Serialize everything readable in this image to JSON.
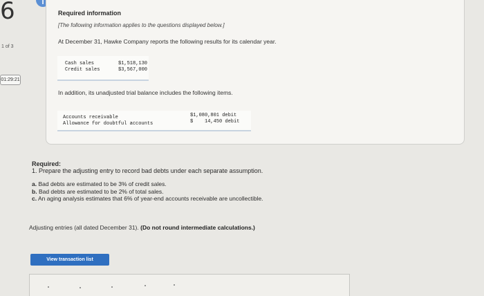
{
  "corner": {
    "question_number": "6",
    "page_count": "1 of 3",
    "timer": "01:29:21",
    "info_icon": "info-icon"
  },
  "info_panel": {
    "title": "Required information",
    "note": "[The following information applies to the questions displayed below.]",
    "intro": "At December 31, Hawke Company reports the following results for its calendar year.",
    "results": [
      {
        "label": "Cash sales",
        "value": "$1,518,130"
      },
      {
        "label": "Credit sales",
        "value": "$3,567,000"
      }
    ],
    "balance_intro": "In addition, its unadjusted trial balance includes the following items.",
    "balances": [
      {
        "label": "Accounts receivable",
        "value": "$1,080,801 debit"
      },
      {
        "label": "Allowance for doubtful accounts",
        "value": "$    14,450 debit"
      }
    ]
  },
  "required": {
    "heading": "Required:",
    "task": "1. Prepare the adjusting entry to record bad debts under each separate assumption.",
    "items": [
      {
        "letter": "a.",
        "text": "Bad debts are estimated to be 3% of credit sales."
      },
      {
        "letter": "b.",
        "text": "Bad debts are estimated to be 2% of total sales."
      },
      {
        "letter": "c.",
        "text": "An aging analysis estimates that 6% of year-end accounts receivable are uncollectible."
      }
    ]
  },
  "adjusting": {
    "text": "Adjusting entries (all dated December 31).",
    "bold_note": "(Do not round intermediate calculations.)"
  },
  "view_button": "View transaction list"
}
